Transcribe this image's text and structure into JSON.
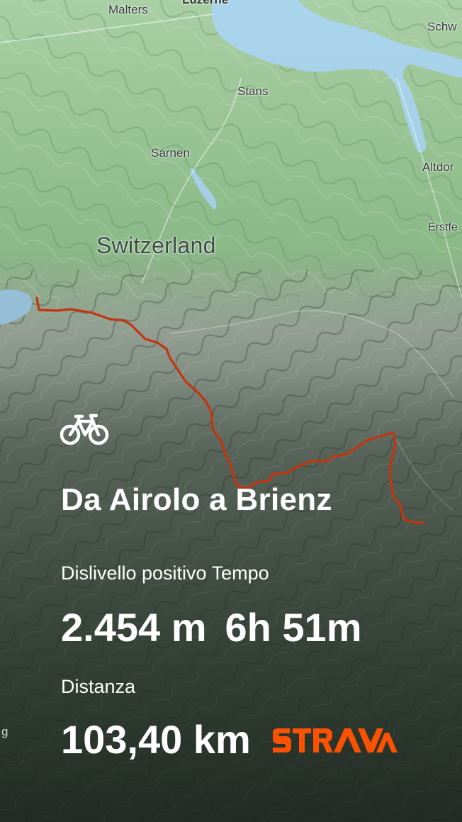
{
  "map": {
    "labels": {
      "malters": "Malters",
      "luzern": "Luzerne",
      "schwyz": "Schw",
      "stans": "Stans",
      "sarnen": "Sarnen",
      "altdorf": "Altdor",
      "erstfeld": "Erstfe",
      "country": "Switzerland",
      "edge_g": "g"
    },
    "route_color": "#c2360f"
  },
  "activity": {
    "sport_icon": "bike-icon",
    "title": "Da Airolo a Brienz",
    "stats_label_row": "Dislivello positivo Tempo",
    "elevation_gain": "2.454 m",
    "moving_time": "6h 51m",
    "distance_label": "Distanza",
    "distance": "103,40 km"
  },
  "branding": {
    "logo_name": "STRAVA",
    "logo_color": "#fc5200"
  }
}
